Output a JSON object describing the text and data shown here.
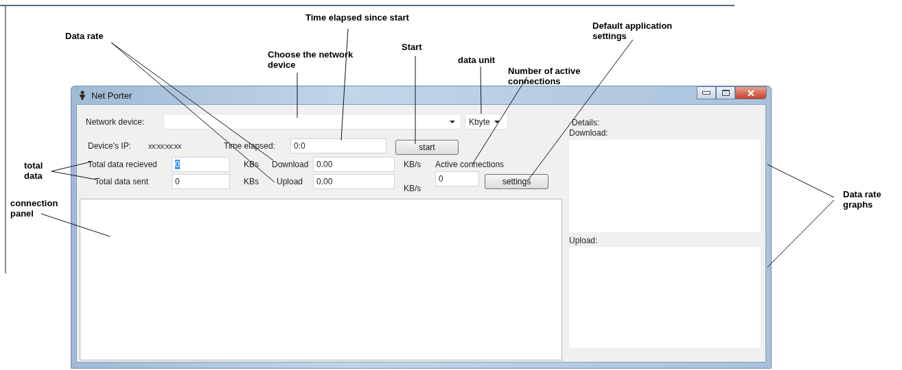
{
  "window": {
    "title": "Net Porter",
    "network_device": {
      "label": "Network device:"
    },
    "unit": {
      "value": "Kbyte"
    },
    "device_ip": {
      "label": "Device's IP:",
      "value": "xx:xx:xx:xx"
    },
    "time_elapsed": {
      "label": "Time elapsed:",
      "value": "0:0"
    },
    "start_button": "start",
    "total_received": {
      "label": "Total data recieved",
      "value": "0",
      "selected": true,
      "unit": "KBs"
    },
    "total_sent": {
      "label": "Total data sent",
      "value": "0",
      "selected": false,
      "unit": "KBs"
    },
    "download": {
      "label": "Download",
      "value": "0.00",
      "unit": "KB/s"
    },
    "upload": {
      "label": "Upload",
      "value": "0.00",
      "unit": "KB/s"
    },
    "active_connections": {
      "label": "Active connections",
      "value": "0"
    },
    "settings_button": "settings",
    "details": {
      "label": "Details:",
      "download_label": "Download:",
      "upload_label": "Upload:"
    }
  },
  "annotations": [
    {
      "text": "Data rate"
    },
    {
      "text": "Time elapsed since start"
    },
    {
      "text": "Choose the network device"
    },
    {
      "text": "Start"
    },
    {
      "text": "data unit"
    },
    {
      "text": "Number of active connections"
    },
    {
      "text": "Default application settings"
    },
    {
      "text": "total data"
    },
    {
      "text": "connection panel"
    },
    {
      "text": "Data rate graphs"
    }
  ]
}
